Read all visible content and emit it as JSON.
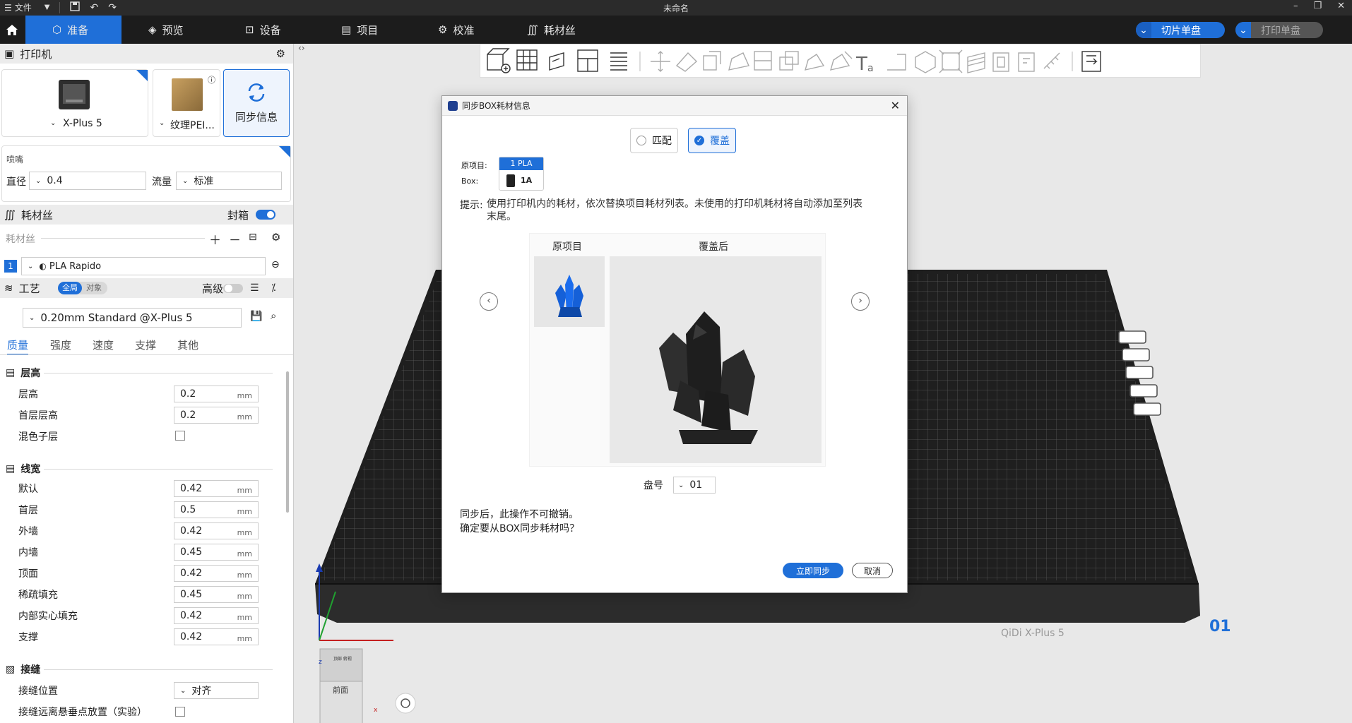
{
  "titlebar": {
    "file_menu": "文件",
    "title": "未命名"
  },
  "nav": {
    "tabs": [
      "准备",
      "预览",
      "设备",
      "项目",
      "校准",
      "耗材丝"
    ],
    "slice_button": "切片单盘",
    "print_button": "打印单盘"
  },
  "printer": {
    "header": "打印机",
    "name": "X-Plus 5",
    "plate": "纹理PEI...",
    "sync_label": "同步信息",
    "nozzle_header": "喷嘴",
    "diameter_label": "直径",
    "diameter_value": "0.4",
    "flow_label": "流量",
    "flow_value": "标准"
  },
  "filament": {
    "header": "耗材丝",
    "enclosure_label": "封箱",
    "sub_label": "耗材丝",
    "slot_index": "1",
    "filament_name": "PLA Rapido"
  },
  "process": {
    "header": "工艺",
    "toggle_global": "全局",
    "toggle_object": "对象",
    "advanced_label": "高级",
    "preset": "0.20mm Standard @X-Plus 5",
    "tabs": [
      "质量",
      "强度",
      "速度",
      "支撑",
      "其他"
    ],
    "unit": "mm",
    "groups": {
      "layer_height": {
        "title": "层高",
        "rows": [
          {
            "label": "层高",
            "value": "0.2"
          },
          {
            "label": "首层层高",
            "value": "0.2"
          }
        ],
        "mixed_label": "混色子层"
      },
      "line_width": {
        "title": "线宽",
        "rows": [
          {
            "label": "默认",
            "value": "0.42"
          },
          {
            "label": "首层",
            "value": "0.5"
          },
          {
            "label": "外墙",
            "value": "0.42"
          },
          {
            "label": "内墙",
            "value": "0.45"
          },
          {
            "label": "顶面",
            "value": "0.42"
          },
          {
            "label": "稀疏填充",
            "value": "0.45"
          },
          {
            "label": "内部实心填充",
            "value": "0.42"
          },
          {
            "label": "支撑",
            "value": "0.42"
          }
        ]
      },
      "seam": {
        "title": "接缝",
        "position_label": "接缝位置",
        "position_value": "对齐",
        "away_label": "接缝远离悬垂点放置（实验）"
      }
    }
  },
  "viewport": {
    "plate_brand": "QiDi X-Plus 5",
    "plate_number": "01",
    "axis_x": "x",
    "axis_z": "z",
    "view_cube_top": "顶部 俯视",
    "view_cube_front": "前面"
  },
  "dialog": {
    "title": "同步BOX耗材信息",
    "option_match": "匹配",
    "option_override": "覆盖",
    "orig_label": "原项目:",
    "box_label": "Box:",
    "orig_chip": "1 PLA",
    "box_chip": "1A",
    "hint_label": "提示:",
    "hint_text": "使用打印机内的耗材，依次替换项目耗材列表。未使用的打印机耗材将自动添加至列表末尾。",
    "col_original": "原项目",
    "col_after": "覆盖后",
    "plate_label": "盘号",
    "plate_value": "01",
    "warn_line1": "同步后，此操作不可撤销。",
    "warn_line2": "确定要从BOX同步耗材吗？",
    "confirm_button": "立即同步",
    "cancel_button": "取消"
  },
  "colors": {
    "accent": "#1f6fd8",
    "titlebar": "#2b2b2b",
    "navbar": "#1c1c1c",
    "crystal_blue": "#1560d8",
    "crystal_dark": "#2a2a2a"
  },
  "icons": [
    "hamburger-menu-icon",
    "save-icon",
    "undo-icon",
    "redo-icon",
    "home-icon",
    "gear-icon",
    "sync-icon",
    "search-icon",
    "close-icon",
    "chevron-left-icon",
    "chevron-right-icon"
  ]
}
